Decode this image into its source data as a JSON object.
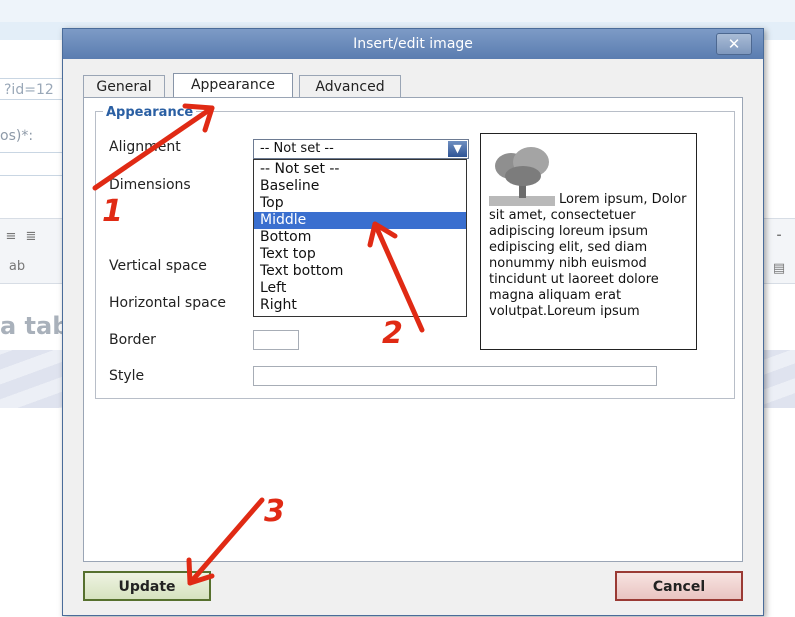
{
  "background": {
    "url_fragment": "?id=12",
    "field_label": "os)*:",
    "heading_fragment": "a tab"
  },
  "dialog": {
    "title": "Insert/edit image",
    "close_icon": "close-icon",
    "tabs": [
      "General",
      "Appearance",
      "Advanced"
    ],
    "active_tab": "Appearance",
    "legend": "Appearance",
    "labels": {
      "alignment": "Alignment",
      "dimensions": "Dimensions",
      "vertical_space": "Vertical space",
      "horizontal_space": "Horizontal space",
      "border": "Border",
      "style": "Style"
    },
    "alignment": {
      "value": "-- Not set --",
      "options": [
        "-- Not set --",
        "Baseline",
        "Top",
        "Middle",
        "Bottom",
        "Text top",
        "Text bottom",
        "Left",
        "Right"
      ],
      "highlighted": "Middle"
    },
    "preview_text": "Lorem ipsum, Dolor sit amet, consectetuer adipiscing loreum ipsum edipiscing elit, sed diam nonummy nibh euismod tincidunt ut laoreet dolore magna aliquam erat volutpat.Loreum ipsum",
    "buttons": {
      "update": "Update",
      "cancel": "Cancel"
    }
  },
  "annotations": {
    "step1": "1",
    "step2": "2",
    "step3": "3",
    "color": "#e02a14"
  }
}
